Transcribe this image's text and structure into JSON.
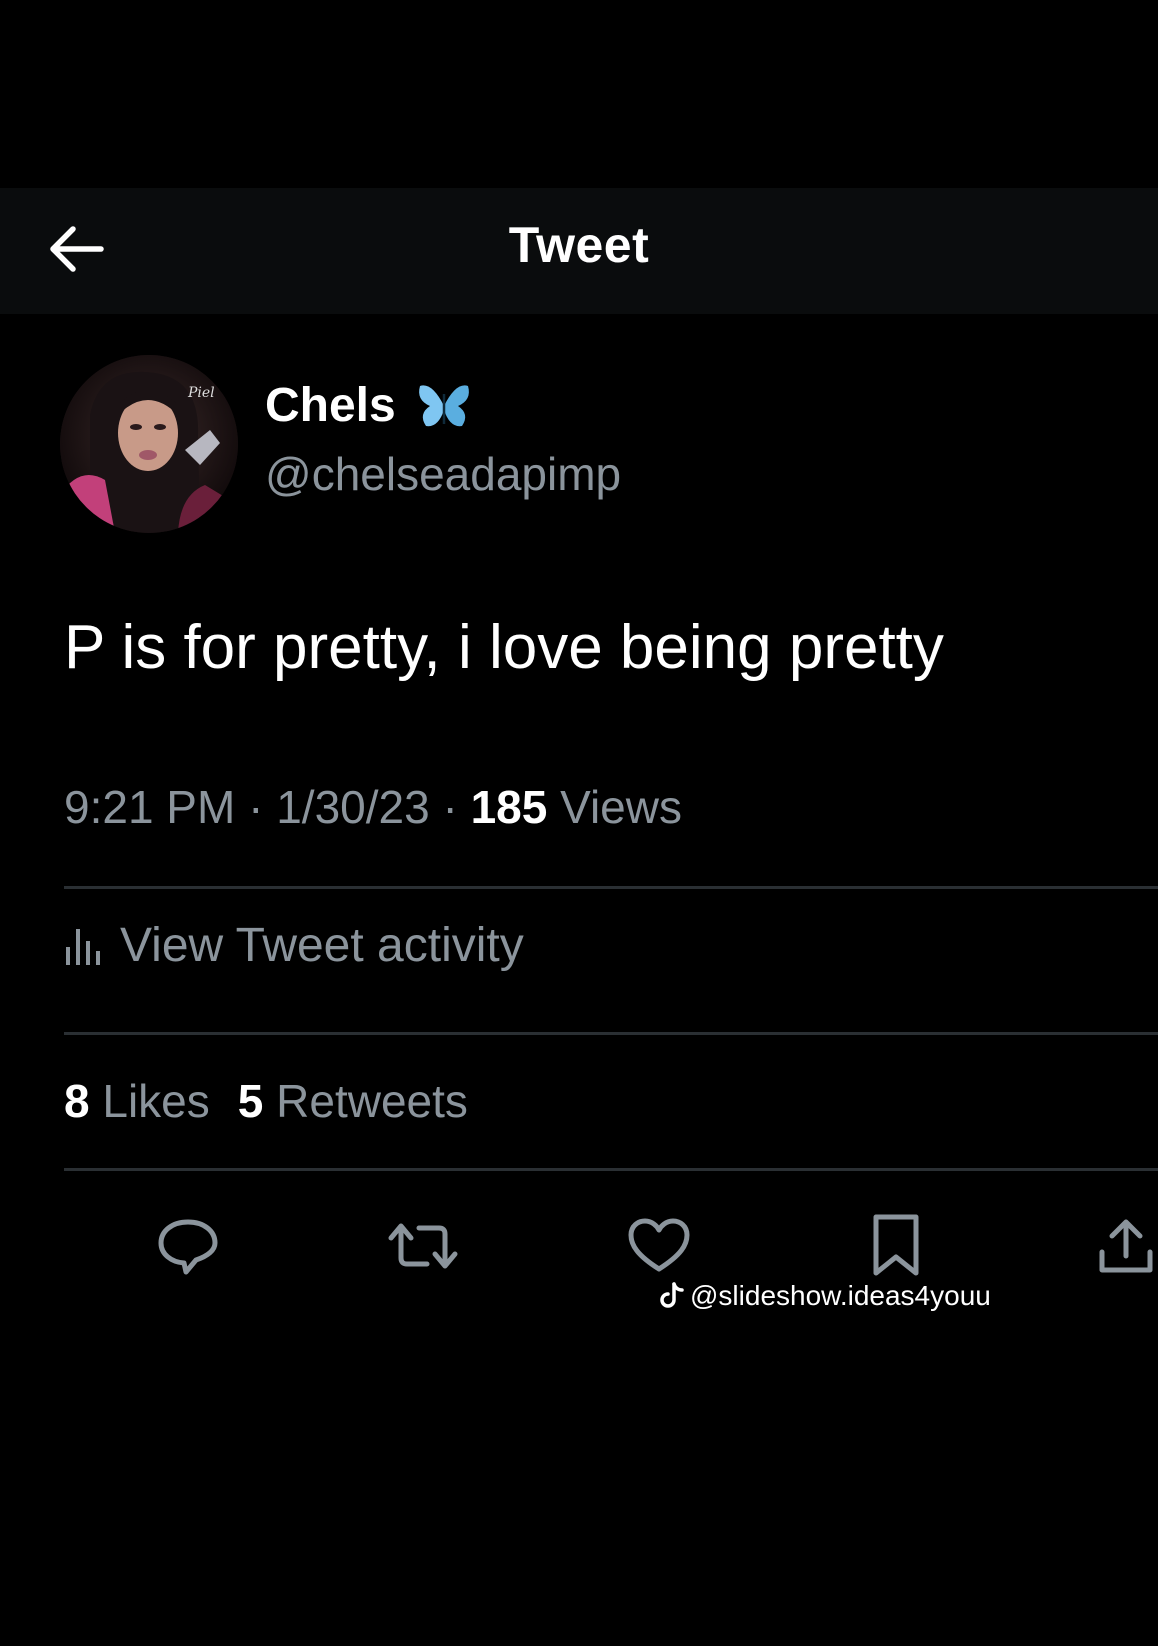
{
  "header": {
    "title": "Tweet",
    "back_icon": "arrow-left-icon"
  },
  "author": {
    "display_name": "Chels",
    "badge_icon": "butterfly-icon",
    "handle": "@chelseadapimp"
  },
  "tweet": {
    "text": "P is for pretty, i love being pretty"
  },
  "meta": {
    "time": "9:21 PM",
    "separator": "·",
    "date": "1/30/23",
    "views_count": "185",
    "views_label": "Views"
  },
  "activity": {
    "icon": "bar-chart-icon",
    "label": "View Tweet activity"
  },
  "stats": {
    "likes_count": "8",
    "likes_label": "Likes",
    "retweets_count": "5",
    "retweets_label": "Retweets"
  },
  "actions": [
    {
      "name": "reply",
      "icon": "speech-bubble-icon"
    },
    {
      "name": "retweet",
      "icon": "retweet-arrows-icon"
    },
    {
      "name": "like",
      "icon": "heart-icon"
    },
    {
      "name": "bookmark",
      "icon": "bookmark-icon"
    },
    {
      "name": "share",
      "icon": "share-upload-icon"
    }
  ],
  "watermark": {
    "icon": "tiktok-note-icon",
    "text": "@slideshow.ideas4youu"
  },
  "colors": {
    "background": "#000000",
    "header_bg": "#0a0c0d",
    "primary_text": "#ffffff",
    "secondary_text": "#8b949c",
    "divider": "#2a2f33",
    "badge_blue": "#7fc6f2"
  }
}
